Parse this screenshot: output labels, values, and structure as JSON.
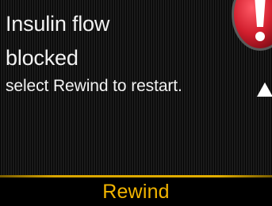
{
  "alert": {
    "title_line_1": "Insulin flow",
    "title_line_2": "blocked",
    "message": "select Rewind to restart.",
    "icon": "alert-exclamation-icon",
    "icon_color": "#d21f2e"
  },
  "scroll": {
    "icon": "scroll-up-arrow-icon"
  },
  "softkey": {
    "label": "Rewind",
    "label_color": "#f1b400",
    "divider_color": "#e2ae00"
  }
}
